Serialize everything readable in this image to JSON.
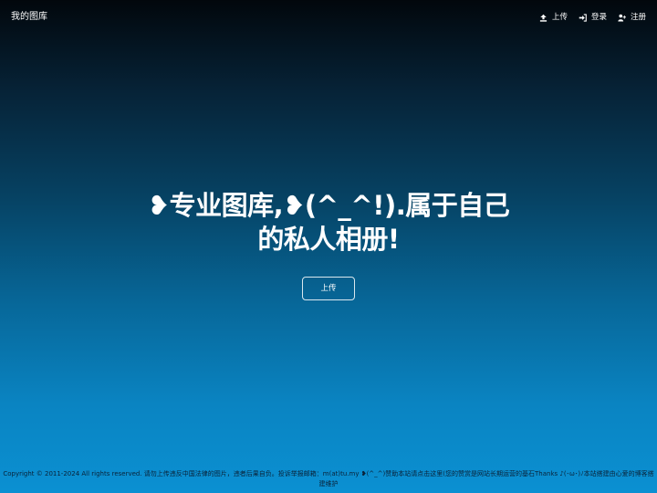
{
  "navbar": {
    "brand": "我的图库",
    "items": [
      {
        "label": "上传",
        "icon": "upload-icon"
      },
      {
        "label": "登录",
        "icon": "sign-in-icon"
      },
      {
        "label": "注册",
        "icon": "user-plus-icon"
      }
    ]
  },
  "hero": {
    "title": "❥专业图库,❥(^_^!).属于自己的私人相册!",
    "button_label": "上传"
  },
  "footer": {
    "text": "Copyright © 2011-2024 All rights reserved. 请勿上传违反中国法律的图片，违者后果自负。投诉举报邮箱：m(at)tu.my ❥(^_^)赞助本站请点击这里(您的赞赏是网站长期运营的基石Thanks ♪(･ω･)ﾉ本站搭建由心爱的博客搭建维护"
  },
  "colors": {
    "background_top": "#02070c",
    "background_bottom": "#0b90d2",
    "text": "#ffffff",
    "footer_text": "#0a2238"
  }
}
